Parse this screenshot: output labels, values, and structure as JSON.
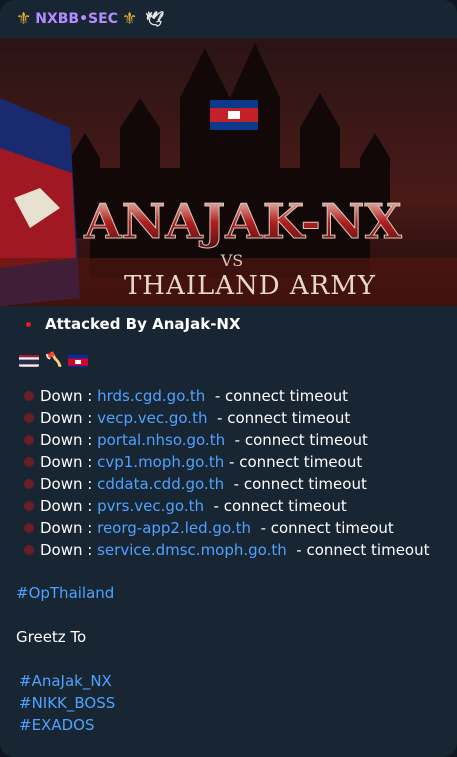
{
  "header": {
    "title": "NXBB•SEC",
    "left_icon": "fleur-de-lis-icon",
    "right_icon": "fleur-de-lis-icon",
    "extra_icon": "dove-icon"
  },
  "banner": {
    "title": "ANAJAK-NX",
    "vs": "VS",
    "subtitle": "THAILAND ARMY"
  },
  "message": {
    "attacked": "Attacked By AnaJak-NX",
    "flags": [
      "thailand-flag-icon",
      "axe-icon",
      "cambodia-flag-icon"
    ],
    "down_label": "Down :",
    "down_status": "- connect timeout",
    "targets": [
      "hrds.cgd.go.th",
      "vecp.vec.go.th",
      "portal.nhso.go.th",
      "cvp1.moph.go.th",
      "cddata.cdd.go.th",
      "pvrs.vec.go.th",
      "reorg-app2.led.go.th",
      "service.dmsc.moph.go.th"
    ],
    "hashtag_op": "#OpThailand",
    "greetz": "Greetz To",
    "greetz_tags": [
      "#AnaJak_NX",
      "#NIKK_BOSS",
      "#EXADOS"
    ]
  },
  "colors": {
    "background": "#182533",
    "link": "#4da3ff",
    "header_name": "#b48cff"
  }
}
